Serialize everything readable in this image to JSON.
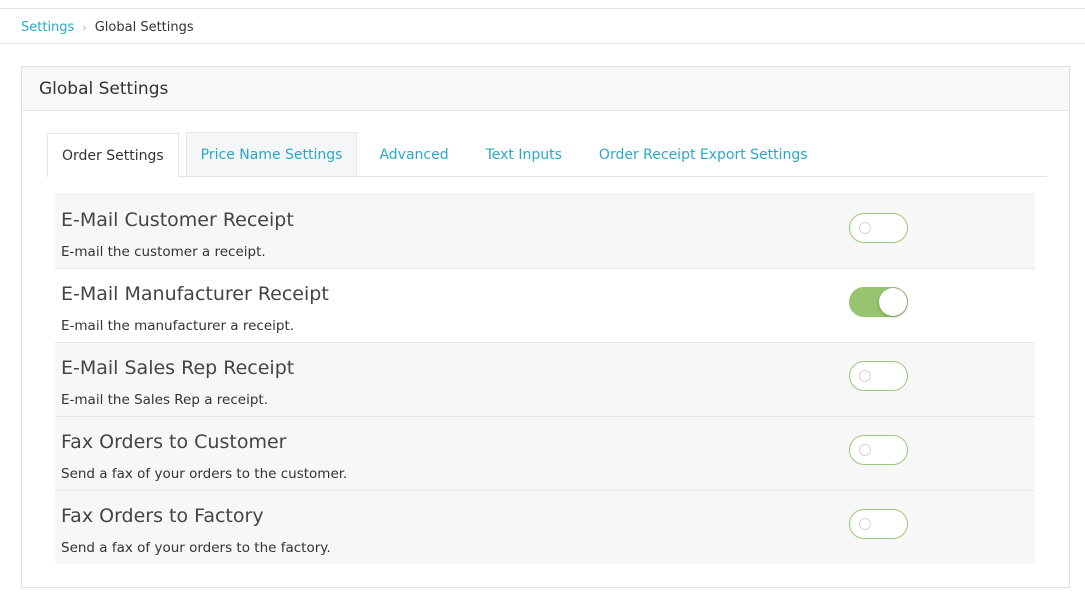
{
  "breadcrumb": {
    "parent": "Settings",
    "separator": "›",
    "current": "Global Settings"
  },
  "panel": {
    "title": "Global Settings"
  },
  "tabs": [
    {
      "label": "Order Settings",
      "active": true
    },
    {
      "label": "Price Name Settings",
      "active": false
    },
    {
      "label": "Advanced",
      "active": false
    },
    {
      "label": "Text Inputs",
      "active": false
    },
    {
      "label": "Order Receipt Export Settings",
      "active": false
    }
  ],
  "settings": [
    {
      "title": "E-Mail Customer Receipt",
      "description": "E-mail the customer a receipt.",
      "enabled": false
    },
    {
      "title": "E-Mail Manufacturer Receipt",
      "description": "E-mail the manufacturer a receipt.",
      "enabled": true
    },
    {
      "title": "E-Mail Sales Rep Receipt",
      "description": "E-mail the Sales Rep a receipt.",
      "enabled": false
    },
    {
      "title": "Fax Orders to Customer",
      "description": "Send a fax of your orders to the customer.",
      "enabled": false
    },
    {
      "title": "Fax Orders to Factory",
      "description": "Send a fax of your orders to the factory.",
      "enabled": false
    }
  ],
  "colors": {
    "link": "#2aa8c8",
    "toggle_on": "#97c46f",
    "toggle_border": "#9cc77a"
  }
}
